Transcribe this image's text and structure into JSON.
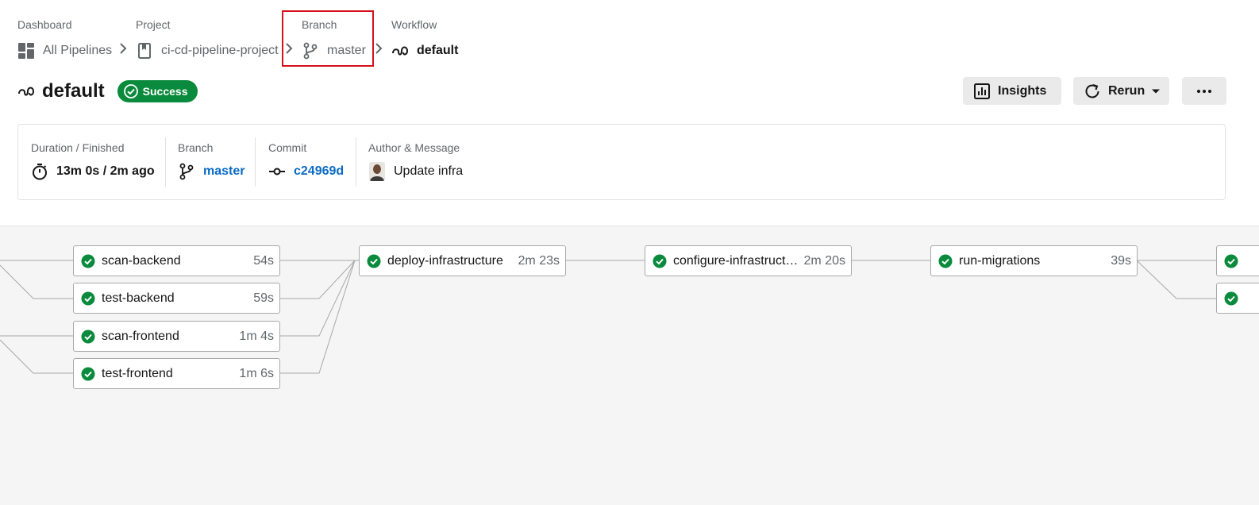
{
  "breadcrumb": {
    "dashboard": {
      "label": "Dashboard",
      "value": "All Pipelines"
    },
    "project": {
      "label": "Project",
      "value": "ci-cd-pipeline-project"
    },
    "branch": {
      "label": "Branch",
      "value": "master"
    },
    "workflow": {
      "label": "Workflow",
      "value": "default"
    }
  },
  "header": {
    "title": "default",
    "status": "Success",
    "status_color": "#0a8a3c",
    "insights_label": "Insights",
    "rerun_label": "Rerun"
  },
  "info": {
    "duration": {
      "label": "Duration / Finished",
      "value": "13m 0s / 2m ago"
    },
    "branch": {
      "label": "Branch",
      "value": "master"
    },
    "commit": {
      "label": "Commit",
      "value": "c24969d"
    },
    "author": {
      "label": "Author & Message",
      "value": "Update infra"
    }
  },
  "jobs": [
    {
      "name": "scan-backend",
      "duration": "54s",
      "status": "success"
    },
    {
      "name": "test-backend",
      "duration": "59s",
      "status": "success"
    },
    {
      "name": "scan-frontend",
      "duration": "1m 4s",
      "status": "success"
    },
    {
      "name": "test-frontend",
      "duration": "1m 6s",
      "status": "success"
    },
    {
      "name": "deploy-infrastructure",
      "duration": "2m 23s",
      "status": "success"
    },
    {
      "name": "configure-infrastructure",
      "duration": "2m 20s",
      "status": "success"
    },
    {
      "name": "run-migrations",
      "duration": "39s",
      "status": "success"
    },
    {
      "name": "",
      "duration": "",
      "status": "success"
    },
    {
      "name": "",
      "duration": "",
      "status": "success"
    }
  ],
  "colors": {
    "link": "#0b6bc4",
    "success": "#0a8a3c",
    "highlight": "#d7111c"
  },
  "icons": {
    "dashboard": "dashboard-icon",
    "project": "project-bookmark-icon",
    "branch": "git-branch-icon",
    "workflow": "workflow-icon",
    "success": "check-circle-icon",
    "insights": "bar-chart-icon",
    "rerun": "refresh-icon",
    "more": "more-horizontal-icon",
    "duration": "stopwatch-icon",
    "commit": "git-commit-icon"
  }
}
